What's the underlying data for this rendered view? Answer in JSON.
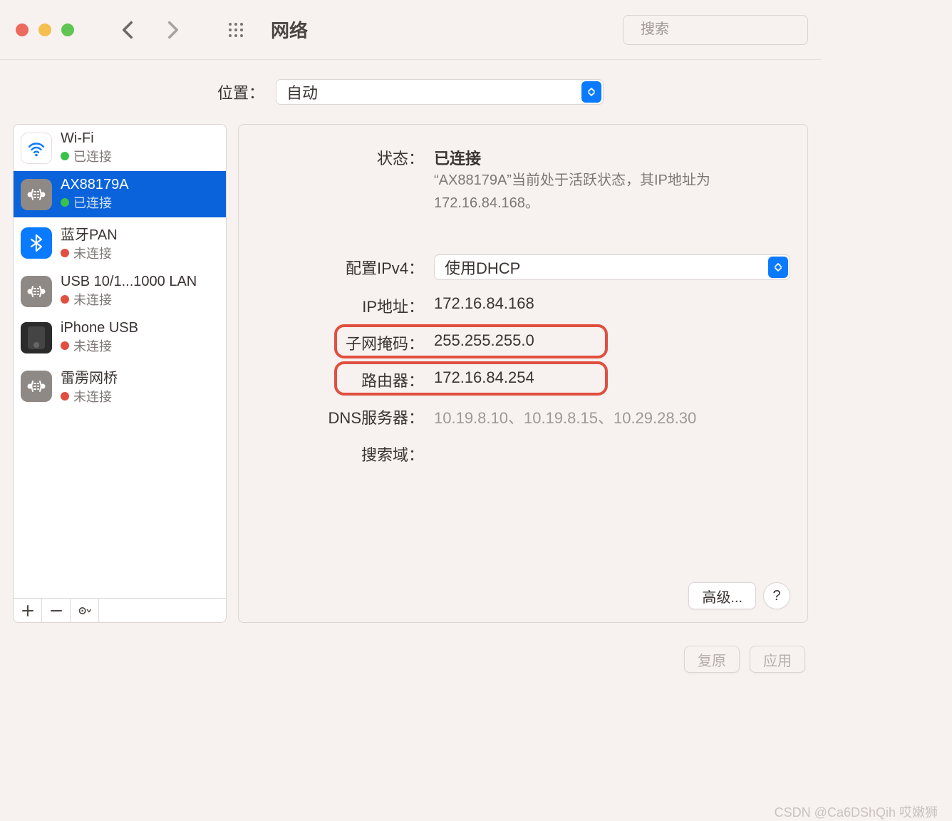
{
  "toolbar": {
    "title": "网络",
    "search_placeholder": "搜索"
  },
  "location": {
    "label": "位置：",
    "value": "自动"
  },
  "sidebar": {
    "items": [
      {
        "name": "Wi-Fi",
        "status_label": "已连接",
        "status": "green",
        "icon": "wifi"
      },
      {
        "name": "AX88179A",
        "status_label": "已连接",
        "status": "green",
        "icon": "eth",
        "selected": true
      },
      {
        "name": "蓝牙PAN",
        "status_label": "未连接",
        "status": "red",
        "icon": "bt"
      },
      {
        "name": "USB 10/1...1000 LAN",
        "status_label": "未连接",
        "status": "red",
        "icon": "eth"
      },
      {
        "name": "iPhone USB",
        "status_label": "未连接",
        "status": "red",
        "icon": "iphone"
      },
      {
        "name": "雷雳网桥",
        "status_label": "未连接",
        "status": "red",
        "icon": "eth"
      }
    ]
  },
  "main": {
    "labels": {
      "status": "状态：",
      "ipv4": "配置IPv4：",
      "ip": "IP地址：",
      "subnet": "子网掩码：",
      "router": "路由器：",
      "dns": "DNS服务器：",
      "domain": "搜索域："
    },
    "status_value": "已连接",
    "status_desc": "“AX88179A”当前处于活跃状态，其IP地址为172.16.84.168。",
    "ipv4_value": "使用DHCP",
    "ip_value": "172.16.84.168",
    "subnet_value": "255.255.255.0",
    "router_value": "172.16.84.254",
    "dns_value": "10.19.8.10、10.19.8.15、10.29.28.30",
    "domain_value": "",
    "advanced_button": "高级..."
  },
  "bottom": {
    "revert": "复原",
    "apply": "应用"
  },
  "watermark": "CSDN @Ca6DShQih 哎嫩狮"
}
